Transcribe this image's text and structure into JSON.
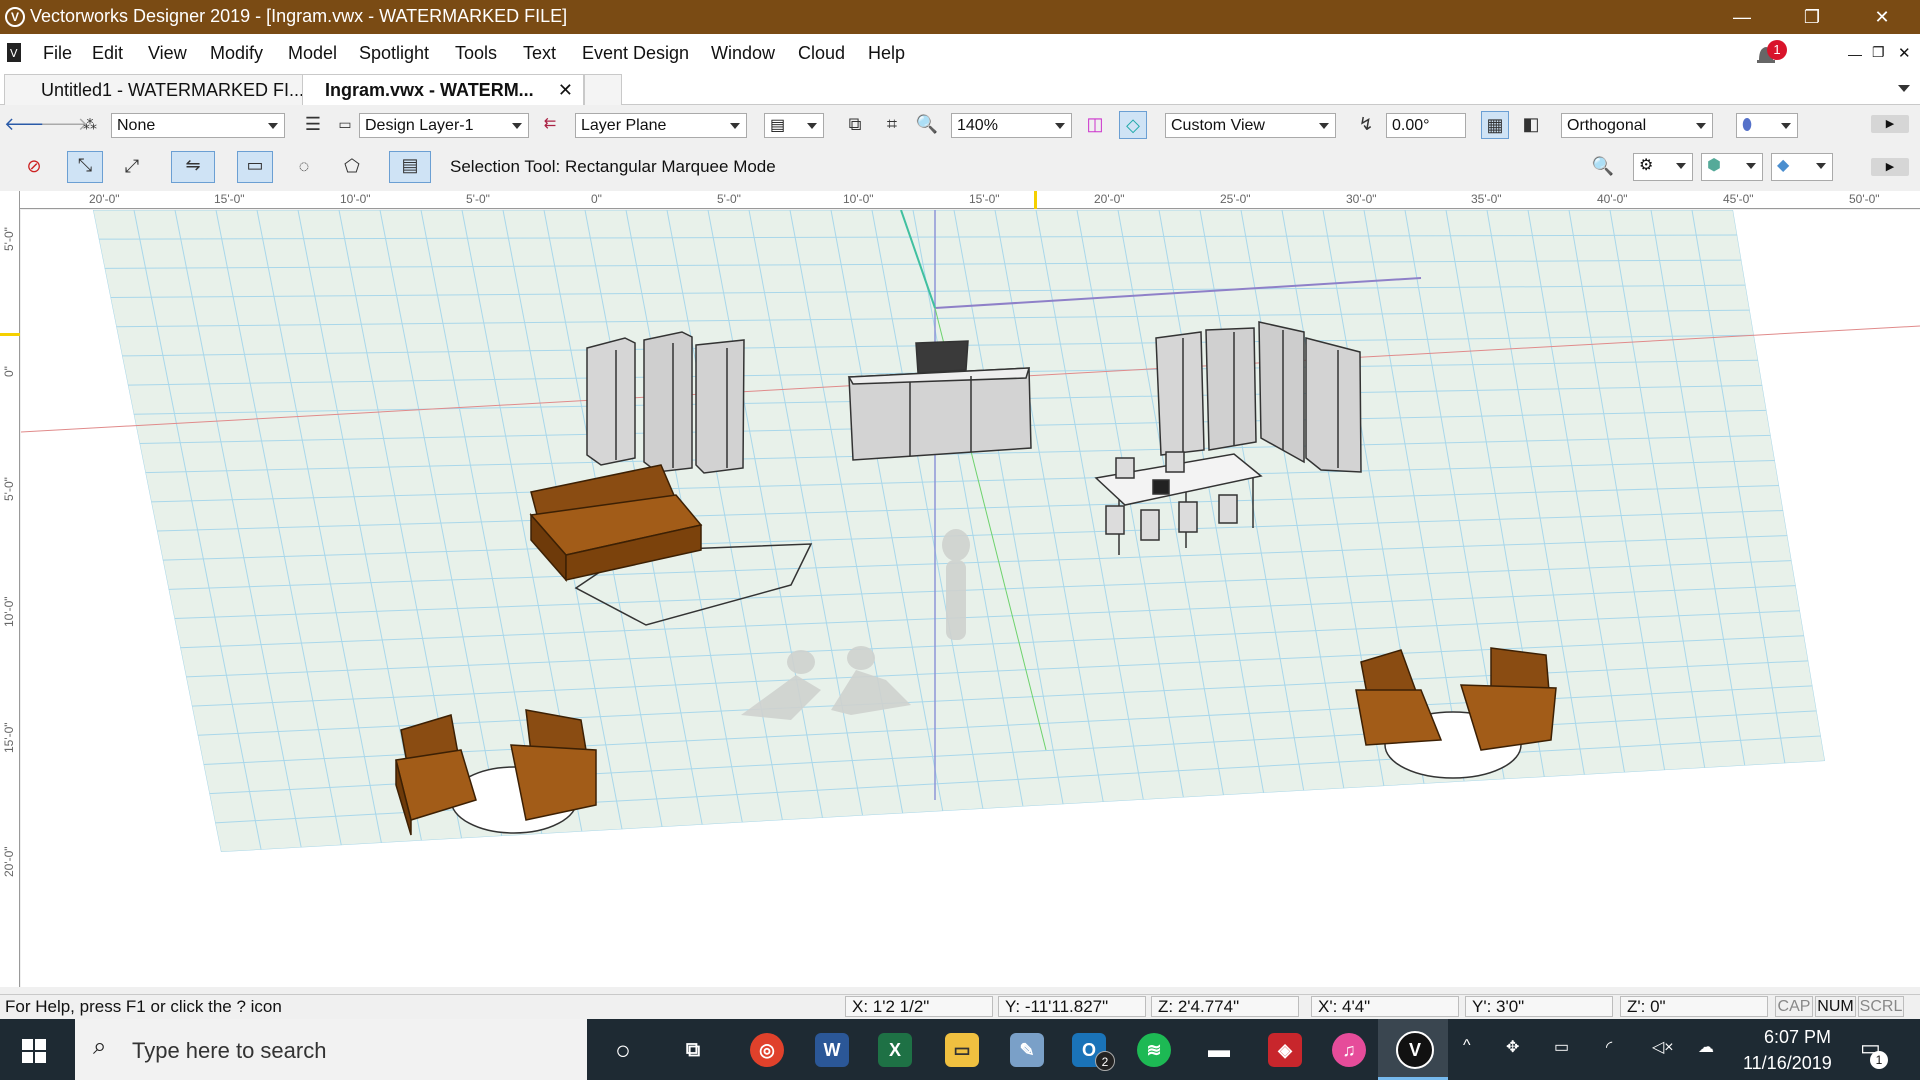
{
  "window": {
    "title": "Vectorworks Designer 2019 - [Ingram.vwx - WATERMARKED FILE]",
    "logo_letter": "V",
    "minimize_glyph": "—",
    "restore_glyph": "❐",
    "close_glyph": "✕"
  },
  "menu": {
    "items": [
      "File",
      "Edit",
      "View",
      "Modify",
      "Model",
      "Spotlight",
      "Tools",
      "Text",
      "Event Design",
      "Window",
      "Cloud",
      "Help"
    ],
    "notification_count": "1"
  },
  "tabs": [
    {
      "label": "Untitled1 - WATERMARKED FI..."
    },
    {
      "label": "Ingram.vwx - WATERM...",
      "close": "✕"
    }
  ],
  "view_bar": {
    "class_value": "None",
    "layer_value": "Design Layer-1",
    "plane_value": "Layer Plane",
    "zoom_value": "140%",
    "view_value": "Custom View",
    "rotation_value": "0.00°",
    "projection_value": "Orthogonal"
  },
  "tool_bar": {
    "mode_text": "Selection Tool: Rectangular Marquee Mode"
  },
  "rulers": {
    "h_labels": [
      "20'-0\"",
      "15'-0\"",
      "10'-0\"",
      "5'-0\"",
      "0\"",
      "5'-0\"",
      "10'-0\"",
      "15'-0\"",
      "20'-0\"",
      "25'-0\"",
      "30'-0\"",
      "35'-0\"",
      "40'-0\"",
      "45'-0\"",
      "50'-0\""
    ],
    "v_labels": [
      "5'-0\"",
      "0\"",
      "5'-0\"",
      "10'-0\"",
      "15'-0\"",
      "20'-0\""
    ]
  },
  "status": {
    "help_text": "For Help, press F1 or click the ? icon",
    "x": "X:  1'2 1/2\"",
    "y": "Y:  -11'11.827\"",
    "z": "Z:  2'4.774\"",
    "dx": "X':  4'4\"",
    "dy": "Y':  3'0\"",
    "dz": "Z':  0\"",
    "cap": "CAP",
    "num": "NUM",
    "scrl": "SCRL"
  },
  "taskbar": {
    "search_placeholder": "Type here to search",
    "time": "6:07 PM",
    "date": "11/16/2019",
    "action_center_count": "1",
    "outlook_badge": "2"
  },
  "colors": {
    "titlebar": "#7a4b14",
    "grid": "#9fd0e6",
    "furniture_brown": "#9c5a16",
    "taskbar": "#1e2a33"
  }
}
